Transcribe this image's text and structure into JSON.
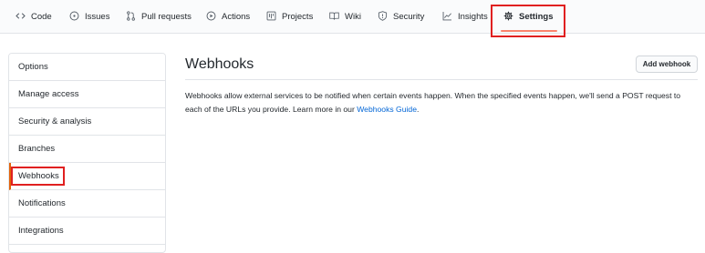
{
  "nav": {
    "tabs": [
      {
        "label": "Code",
        "icon": "code-icon"
      },
      {
        "label": "Issues",
        "icon": "issue-opened-icon"
      },
      {
        "label": "Pull requests",
        "icon": "git-pull-request-icon"
      },
      {
        "label": "Actions",
        "icon": "play-icon"
      },
      {
        "label": "Projects",
        "icon": "project-icon"
      },
      {
        "label": "Wiki",
        "icon": "book-icon"
      },
      {
        "label": "Security",
        "icon": "shield-icon"
      },
      {
        "label": "Insights",
        "icon": "graph-icon"
      },
      {
        "label": "Settings",
        "icon": "gear-icon",
        "selected": true
      }
    ]
  },
  "sidebar": {
    "items": [
      {
        "label": "Options"
      },
      {
        "label": "Manage access"
      },
      {
        "label": "Security & analysis"
      },
      {
        "label": "Branches"
      },
      {
        "label": "Webhooks",
        "active": true
      },
      {
        "label": "Notifications"
      },
      {
        "label": "Integrations"
      }
    ]
  },
  "main": {
    "title": "Webhooks",
    "add_button_label": "Add webhook",
    "description_text": "Webhooks allow external services to be notified when certain events happen. When the specified events happen, we'll send a POST request to each of the URLs you provide. Learn more in our ",
    "description_link": "Webhooks Guide",
    "description_end": "."
  },
  "colors": {
    "link": "#0366d6",
    "highlight": "#e02020",
    "selected_underline": "#f9826c",
    "active_marker": "#e36209"
  }
}
